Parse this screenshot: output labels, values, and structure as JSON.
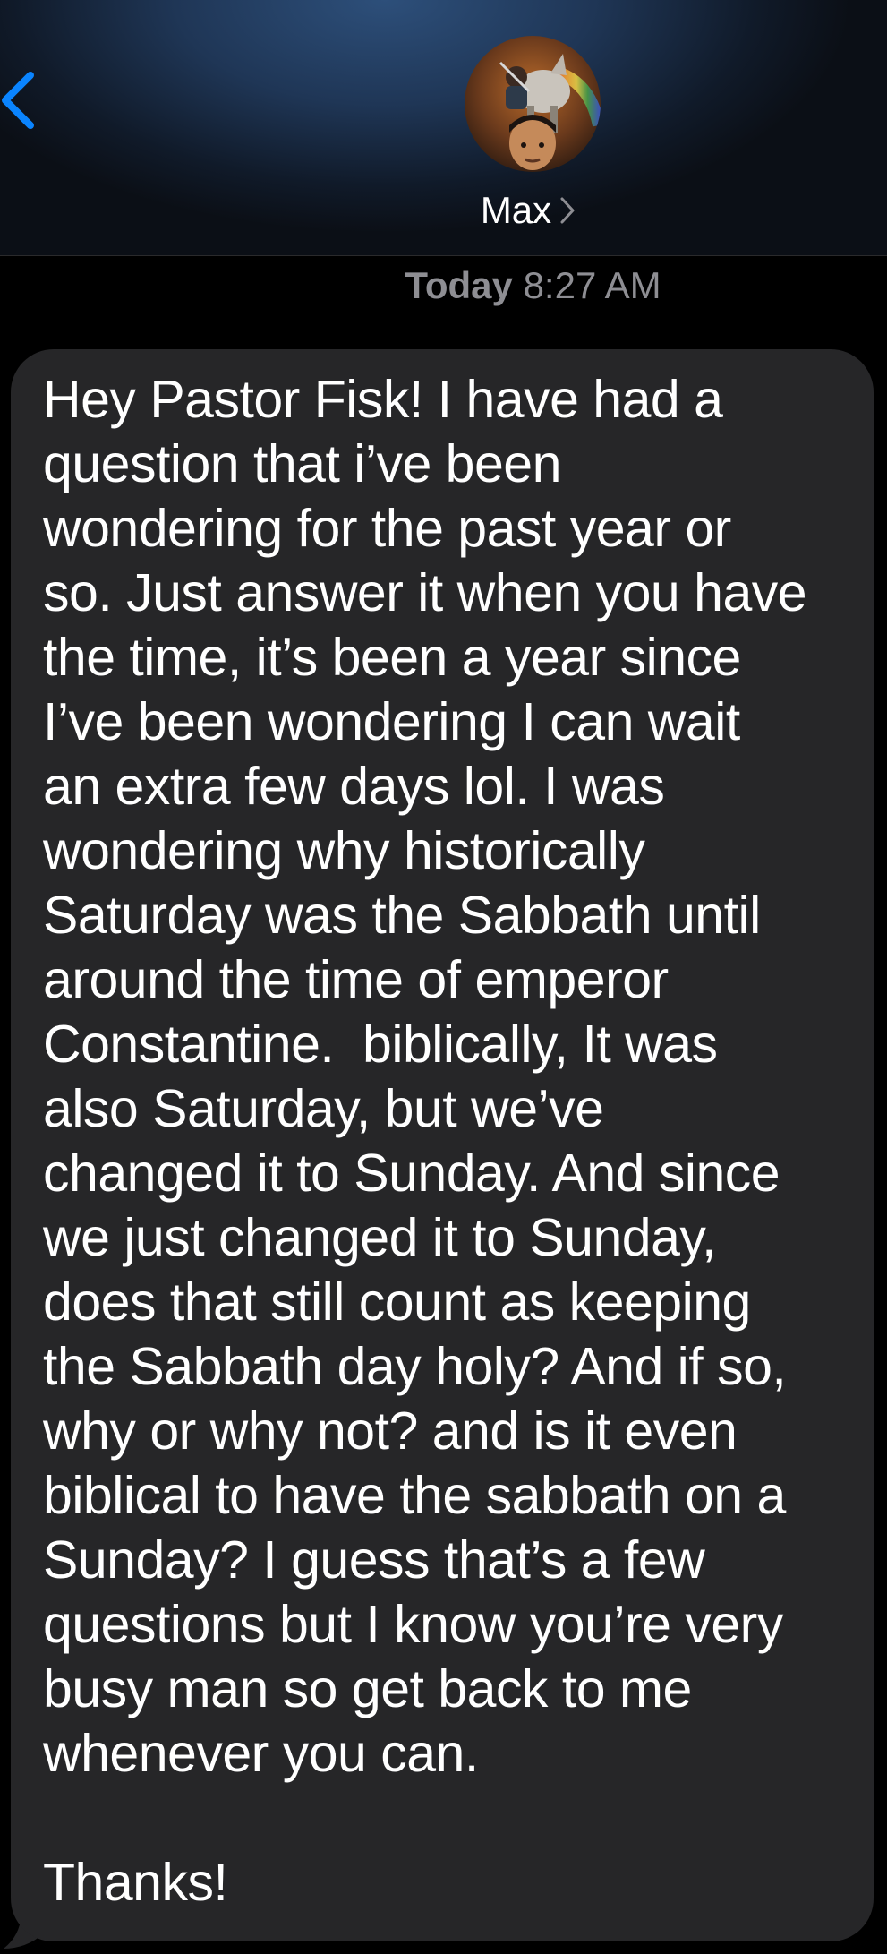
{
  "header": {
    "contact_name": "Max",
    "colors": {
      "accent": "#0a84ff",
      "header_bg": "#1f3656"
    }
  },
  "timestamp": {
    "day": "Today",
    "time": "8:27 AM"
  },
  "message": {
    "lines": [
      "Hey Pastor Fisk! I have had a",
      "question that i’ve been",
      "wondering for the past year or",
      "so. Just answer it when you have",
      "the time, it’s been a year since",
      "I’ve been wondering I can wait",
      "an extra few days lol. I was",
      "wondering why historically",
      "Saturday was the Sabbath until",
      "around the time of emperor",
      "Constantine.  biblically, It was",
      "also Saturday, but we’ve",
      "changed it to Sunday. And since",
      "we just changed it to Sunday,",
      "does that still count as keeping",
      "the Sabbath day holy? And if so,",
      "why or why not? and is it even",
      "biblical to have the sabbath on a",
      "Sunday? I guess that’s a few",
      "questions but I know you’re very",
      "busy man so get back to me",
      "whenever you can.",
      "",
      "Thanks!"
    ],
    "bubble_color": "#262628"
  },
  "icons": {
    "back": "chevron-left-icon",
    "contact_chevron": "chevron-right-icon"
  }
}
